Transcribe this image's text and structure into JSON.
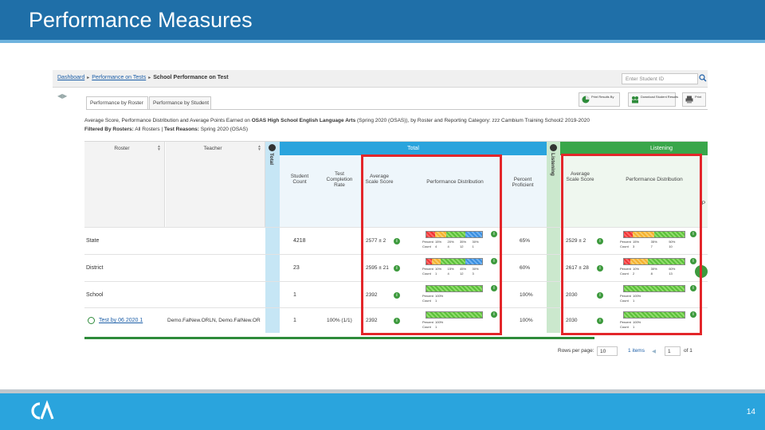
{
  "slide": {
    "title": "Performance Measures",
    "page_number": "14",
    "colors": {
      "header": "#1f6fa8",
      "footer": "#2aa4dd",
      "highlight": "#e3262a"
    }
  },
  "app": {
    "breadcrumb": [
      "Dashboard",
      "Performance on Tests",
      "School Performance on Test"
    ],
    "search_placeholder": "Enter Student ID",
    "tabs": [
      "Performance by Roster",
      "Performance by Student"
    ],
    "toolbar": {
      "print_by": "Print Results By",
      "download": "Download Student Results",
      "print": "Print"
    },
    "report_title_prefix": "Average Score, Performance Distribution and Average Points Earned on",
    "report_title_test": "OSAS High School English Language Arts",
    "report_title_suffix": "(Spring 2020 (OSAS)), by Roster and Reporting Category: zzz Cambium Training School2 2019-2020",
    "filter_label": "Filtered By Rosters:",
    "filter_rosters": "All Rosters",
    "filter_reasons_label": "Test Reasons:",
    "filter_reasons": "Spring 2020 (OSAS)",
    "columns": {
      "roster": "Roster",
      "teacher": "Teacher",
      "total_band": "Total",
      "total_vertical": "Total",
      "listening_band": "Listening",
      "listening_vertical": "Listening",
      "student_count": "Student Count",
      "test_completion_rate": "Test Completion Rate",
      "avg_scale_score": "Average Scale Score",
      "perf_dist": "Performance Distribution",
      "percent_proficient": "Percent Proficient",
      "l_avg_scale_score": "Average Scale Score",
      "l_perf_dist": "Performance Distribution",
      "truncated": "P"
    },
    "rows": [
      {
        "roster": "State",
        "teacher": "",
        "student_count": "4218",
        "completion": "",
        "avg": "2577 ± 2",
        "proficient": "65%",
        "l_avg": "2529 ± 2",
        "dist": {
          "values": [
            0.15,
            0.2,
            0.35,
            0.3
          ],
          "labels": [
            "Percent",
            "15%",
            "20%",
            "35%",
            "30%"
          ],
          "counts": [
            "Count",
            "4",
            "4",
            "12",
            "1"
          ]
        },
        "l_dist": {
          "values": [
            0.15,
            0.35,
            0.5
          ],
          "labels": [
            "Percent",
            "15%",
            "35%",
            "50%"
          ],
          "counts": [
            "Count",
            "3",
            "7",
            "10"
          ]
        }
      },
      {
        "roster": "District",
        "teacher": "",
        "student_count": "23",
        "completion": "",
        "avg": "2595 ± 21",
        "proficient": "60%",
        "l_avg": "2617 ± 28",
        "dist": {
          "values": [
            0.1,
            0.15,
            0.45,
            0.3
          ],
          "labels": [
            "Percent",
            "10%",
            "15%",
            "45%",
            "30%"
          ],
          "counts": [
            "Count",
            "1",
            "4",
            "12",
            "3"
          ]
        },
        "l_dist": {
          "values": [
            0.1,
            0.3,
            0.6
          ],
          "labels": [
            "Percent",
            "10%",
            "30%",
            "60%"
          ],
          "counts": [
            "Count",
            "2",
            "8",
            "13"
          ]
        }
      },
      {
        "roster": "School",
        "teacher": "",
        "student_count": "1",
        "completion": "",
        "avg": "2392",
        "proficient": "100%",
        "l_avg": "2030",
        "dist": {
          "values": [
            0,
            0,
            1.0,
            0
          ],
          "labels": [
            "Percent",
            "100%"
          ],
          "counts": [
            "Count",
            "1"
          ]
        },
        "l_dist": {
          "values": [
            0,
            0,
            1.0
          ],
          "labels": [
            "Percent",
            "100%"
          ],
          "counts": [
            "Count",
            "1"
          ]
        }
      },
      {
        "roster": "Test by 06 2020 1",
        "teacher": "Demo.FalNew.ORLN, Demo.FalNew.OR",
        "student_count": "1",
        "completion": "100% (1/1)",
        "avg": "2392",
        "proficient": "100%",
        "l_avg": "2030",
        "dist": {
          "values": [
            0,
            0,
            1.0,
            0
          ],
          "labels": [
            "Percent",
            "100%"
          ],
          "counts": [
            "Count",
            "1"
          ]
        },
        "l_dist": {
          "values": [
            0,
            0,
            1.0
          ],
          "labels": [
            "Percent",
            "100%"
          ],
          "counts": [
            "Count",
            "1"
          ]
        }
      }
    ],
    "pager": {
      "rows_per_page_label": "Rows per page:",
      "rows_per_page": "10",
      "items": "1 items",
      "page": "1",
      "of": "of 1"
    }
  }
}
